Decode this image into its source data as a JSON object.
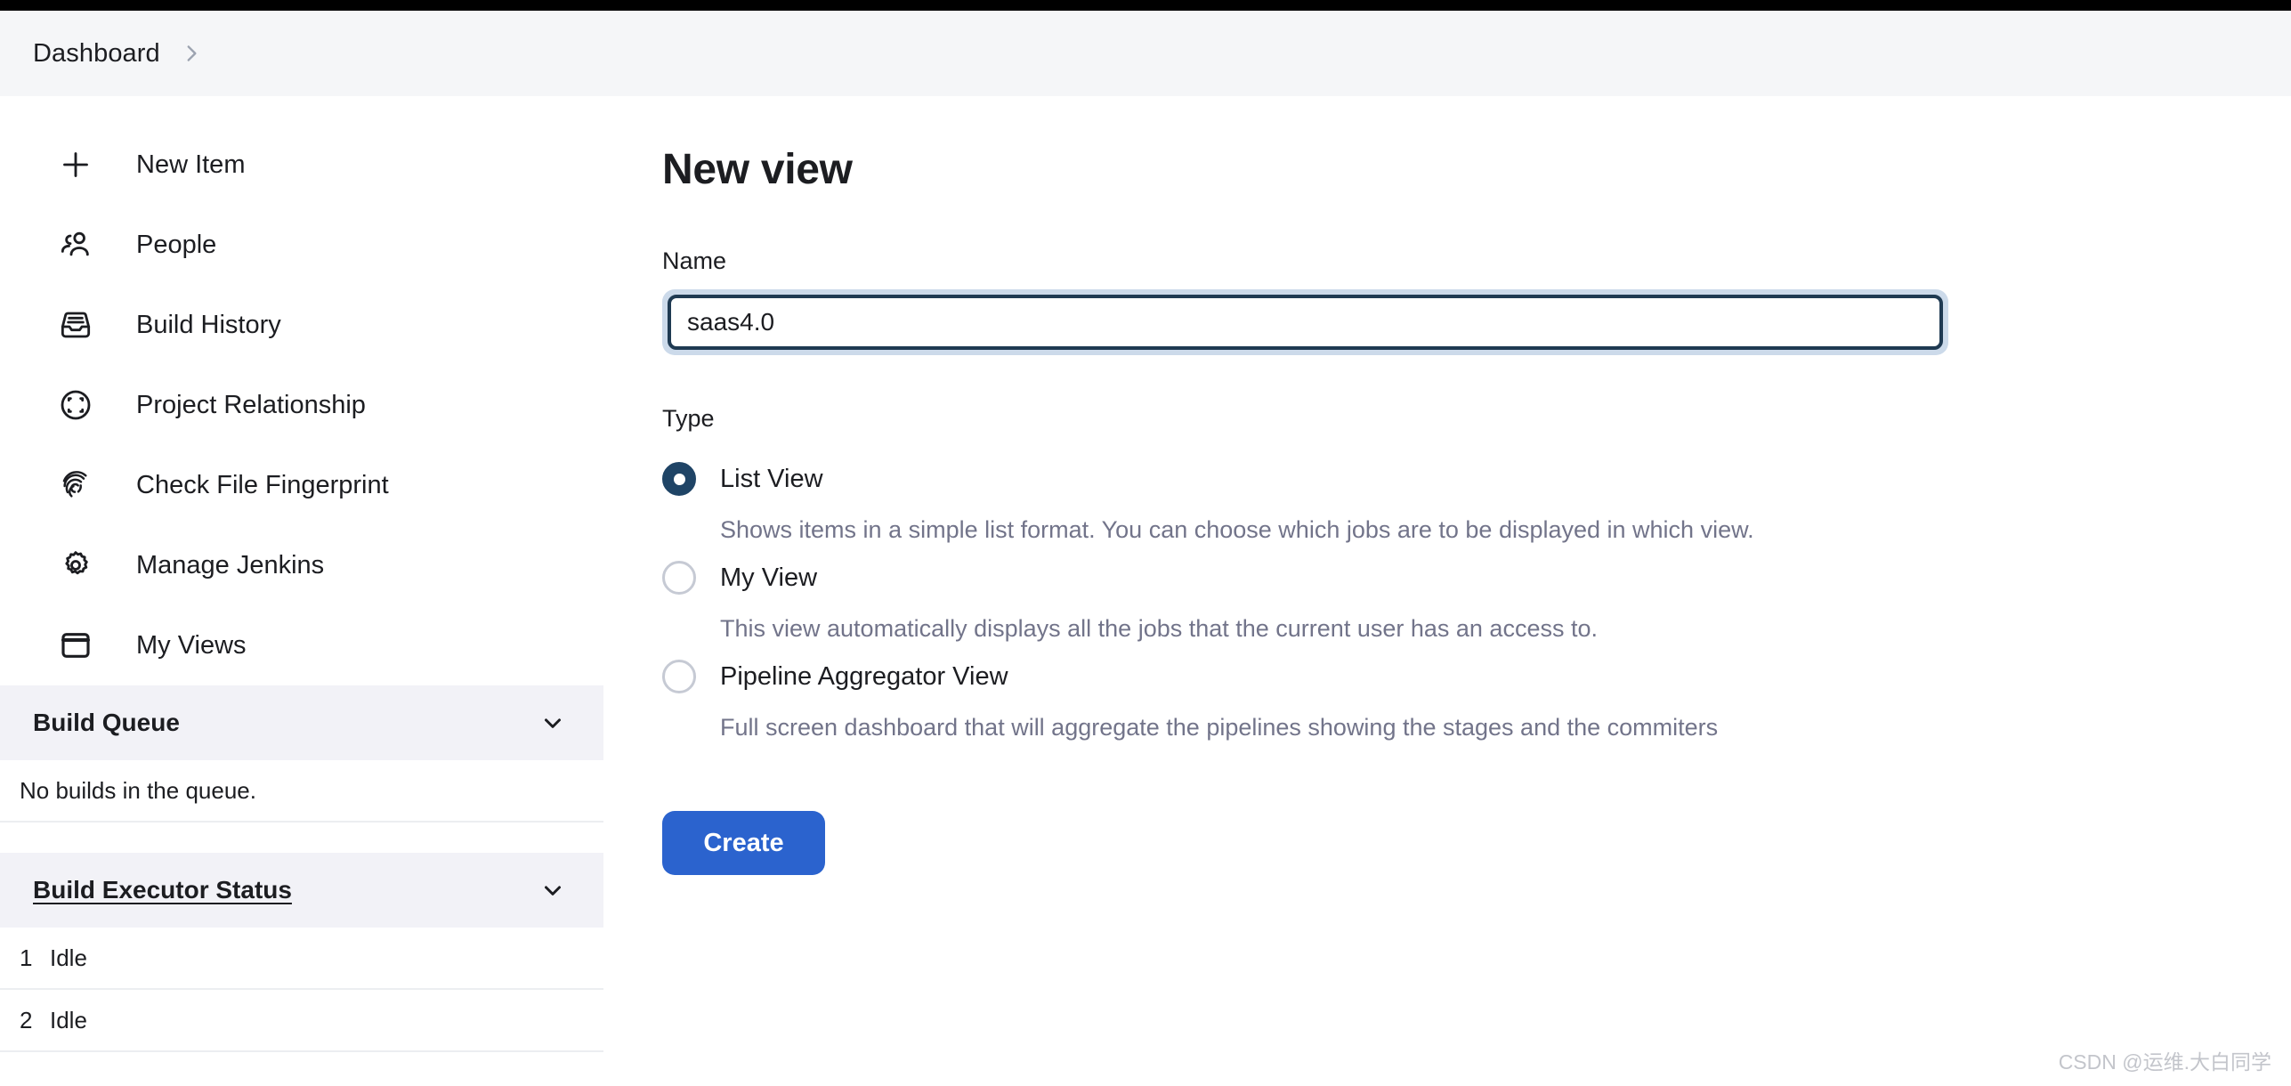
{
  "breadcrumb": {
    "root_label": "Dashboard",
    "separator_icon": "chevron-right-icon"
  },
  "sidebar": {
    "items": [
      {
        "label": "New Item",
        "icon": "plus-icon"
      },
      {
        "label": "People",
        "icon": "people-icon"
      },
      {
        "label": "Build History",
        "icon": "inbox-icon"
      },
      {
        "label": "Project Relationship",
        "icon": "focus-circle-icon"
      },
      {
        "label": "Check File Fingerprint",
        "icon": "fingerprint-icon"
      },
      {
        "label": "Manage Jenkins",
        "icon": "gear-icon"
      },
      {
        "label": "My Views",
        "icon": "window-icon"
      }
    ],
    "build_queue": {
      "title": "Build Queue",
      "collapse_icon": "chevron-down-icon",
      "empty_message": "No builds in the queue."
    },
    "build_executor_status": {
      "title": "Build Executor Status",
      "collapse_icon": "chevron-down-icon",
      "executors": [
        {
          "number": "1",
          "status": "Idle"
        },
        {
          "number": "2",
          "status": "Idle"
        }
      ]
    }
  },
  "main": {
    "page_title": "New view",
    "name_field": {
      "label": "Name",
      "value": "saas4.0"
    },
    "type_field": {
      "label": "Type",
      "options": [
        {
          "label": "List View",
          "description": "Shows items in a simple list format. You can choose which jobs are to be displayed in which view.",
          "selected": true
        },
        {
          "label": "My View",
          "description": "This view automatically displays all the jobs that the current user has an access to.",
          "selected": false
        },
        {
          "label": "Pipeline Aggregator View",
          "description": "Full screen dashboard that will aggregate the pipelines showing the stages and the commiters",
          "selected": false
        }
      ]
    },
    "create_button_label": "Create"
  },
  "watermark": {
    "text": "CSDN @运维.大白同学"
  },
  "colors": {
    "accent_blue": "#2b63ce",
    "radio_selected": "#1f4466",
    "input_border": "#1f3a52",
    "input_focus_ring": "#ccdaea",
    "panel_header_bg": "#f2f2f7",
    "breadcrumb_bg": "#f5f6f8",
    "muted_text": "#72748a"
  }
}
